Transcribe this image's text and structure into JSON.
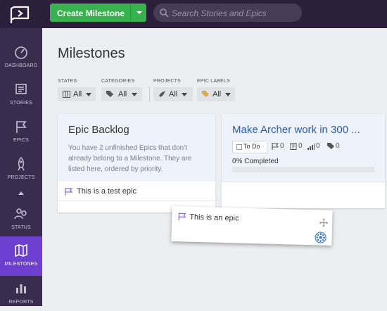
{
  "topbar": {
    "create_label": "Create Milestone",
    "search_placeholder": "Search Stories and Epics"
  },
  "sidebar": {
    "items": [
      {
        "label": "DASHBOARD",
        "icon": "gauge-icon"
      },
      {
        "label": "STORIES",
        "icon": "stories-icon"
      },
      {
        "label": "EPICS",
        "icon": "flags-icon"
      },
      {
        "label": "PROJECTS",
        "icon": "rocket-icon"
      },
      {
        "label": "STATUS",
        "icon": "people-icon"
      },
      {
        "label": "MILESTONES",
        "icon": "map-icon",
        "active": true
      },
      {
        "label": "REPORTS",
        "icon": "bar-chart-icon"
      }
    ]
  },
  "main": {
    "title": "Milestones",
    "filters": [
      {
        "label": "STATES",
        "value": "All"
      },
      {
        "label": "CATEGORIES",
        "value": "All"
      },
      {
        "label": "PROJECTS",
        "value": "All"
      },
      {
        "label": "EPIC LABELS",
        "value": "All"
      }
    ]
  },
  "backlog": {
    "title": "Epic Backlog",
    "description": "You have 2 unfinished Epics that don't already belong to a Milestone. They are listed here, ordered by priority.",
    "epics": [
      "This is a test epic"
    ]
  },
  "milestone": {
    "title": "Make Archer work in 300 ...",
    "state": "To Do",
    "stats": [
      "0",
      "0",
      "0",
      "0"
    ],
    "completed_text": "0% Completed",
    "progress": 0
  },
  "dragged_epic": {
    "title": "This is an epic"
  },
  "colors": {
    "topbar": "#2c1f3c",
    "sidebar": "#3a2c4c",
    "active": "#6c3fd1",
    "create": "#38b24e",
    "link": "#2b5aa8"
  }
}
